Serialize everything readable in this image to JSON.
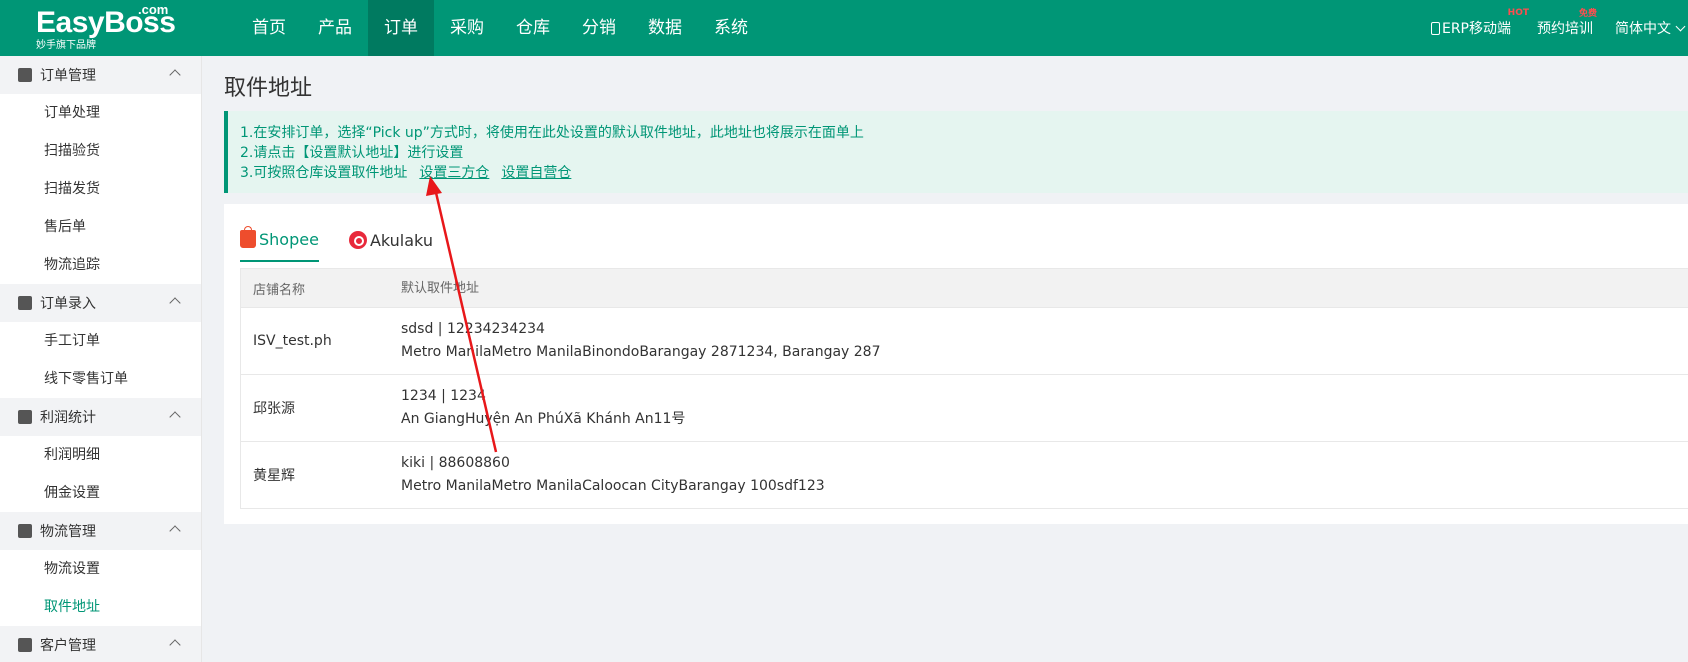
{
  "brand": {
    "name": "EasyBoss",
    "com": ".com",
    "tagline": "妙手旗下品牌"
  },
  "nav": [
    "首页",
    "产品",
    "订单",
    "采购",
    "仓库",
    "分销",
    "数据",
    "系统"
  ],
  "nav_active": "订单",
  "topright": {
    "erp_mobile": "ERP移动端",
    "hot_badge": "HOT",
    "training": "预约培训",
    "free_badge": "免费",
    "language": "简体中文"
  },
  "sidebar": [
    {
      "title": "订单管理",
      "items": [
        "订单处理",
        "扫描验货",
        "扫描发货",
        "售后单",
        "物流追踪"
      ]
    },
    {
      "title": "订单录入",
      "items": [
        "手工订单",
        "线下零售订单"
      ]
    },
    {
      "title": "利润统计",
      "items": [
        "利润明细",
        "佣金设置"
      ]
    },
    {
      "title": "物流管理",
      "items": [
        "物流设置",
        "取件地址"
      ]
    },
    {
      "title": "客户管理",
      "items": []
    }
  ],
  "sidebar_active_item": "取件地址",
  "page": {
    "title": "取件地址",
    "notice": {
      "line1": "1.在安排订单，选择“Pick up”方式时，将使用在此处设置的默认取件地址，此地址也将展示在面单上",
      "line2": "2.请点击【设置默认地址】进行设置",
      "line3": "3.可按照仓库设置取件地址",
      "link1": "设置三方仓",
      "link2": "设置自营仓"
    },
    "tabs": [
      {
        "label": "Shopee",
        "icon": "shopee-icon",
        "active": true
      },
      {
        "label": "Akulaku",
        "icon": "akulaku-icon",
        "active": false
      }
    ],
    "table": {
      "headers": [
        "店铺名称",
        "默认取件地址"
      ],
      "rows": [
        {
          "shop": "ISV_test.ph",
          "contact": "sdsd | 12234234234",
          "address": "Metro ManilaMetro ManilaBinondoBarangay 2871234, Barangay 287"
        },
        {
          "shop": "邱张源",
          "contact": "1234 | 1234",
          "address": "An GiangHuyện An PhúXã Khánh An11号"
        },
        {
          "shop": "黄星辉",
          "contact": "kiki | 88608860",
          "address": "Metro ManilaMetro ManilaCaloocan CityBarangay 100sdf123"
        }
      ]
    }
  },
  "colors": {
    "primary": "#009676",
    "nav_active": "#007a60",
    "annotation_arrow": "#e8171a"
  }
}
